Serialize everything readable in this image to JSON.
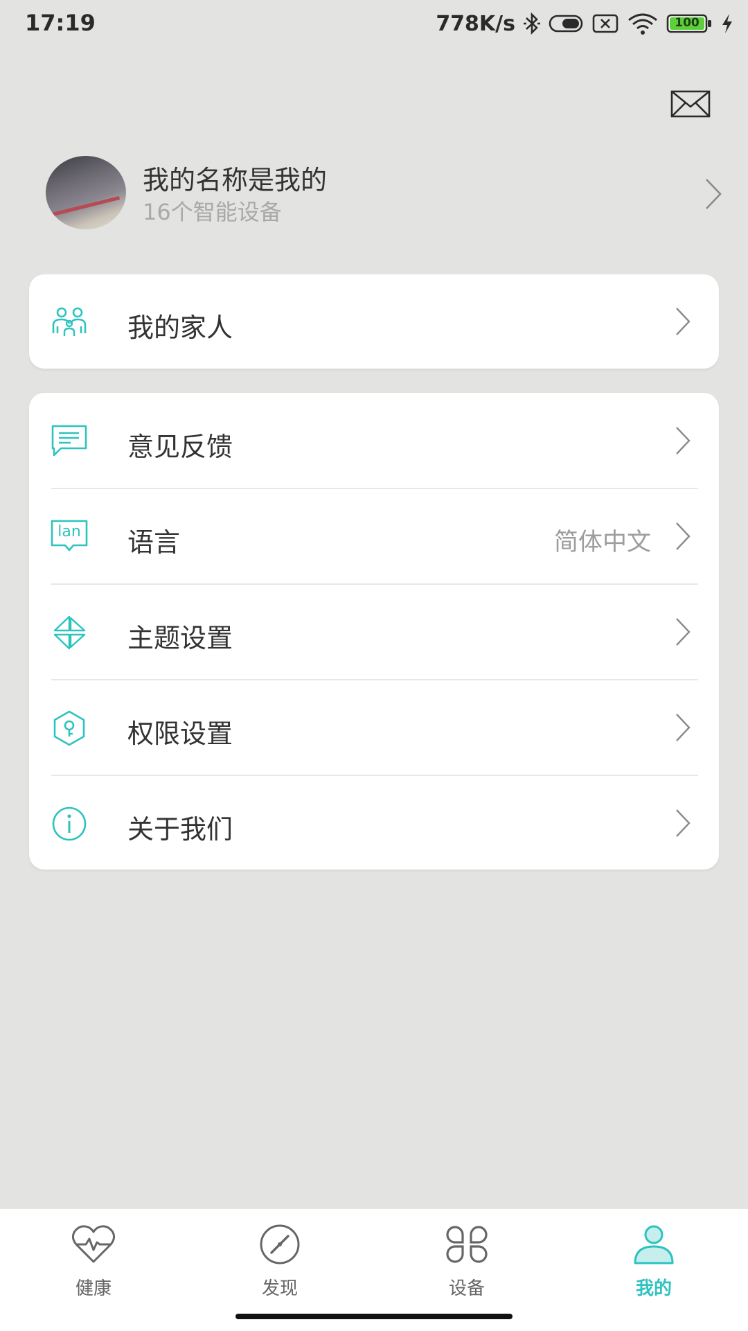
{
  "status_bar": {
    "time": "17:19",
    "net_speed": "778K/s",
    "battery": "100",
    "icons": [
      "bluetooth-icon",
      "toggle-icon",
      "sim-x-icon",
      "wifi-icon",
      "battery-icon",
      "charging-icon"
    ]
  },
  "header": {
    "mail_icon": "mail-icon"
  },
  "profile": {
    "name": "我的名称是我的",
    "device_count": "16个智能设备"
  },
  "family": {
    "label": "我的家人",
    "icon": "family-icon"
  },
  "menu": [
    {
      "label": "意见反馈",
      "icon": "feedback-icon",
      "value": ""
    },
    {
      "label": "语言",
      "icon": "language-icon",
      "icon_text": "lan",
      "value": "简体中文"
    },
    {
      "label": "主题设置",
      "icon": "theme-icon",
      "value": ""
    },
    {
      "label": "权限设置",
      "icon": "permission-icon",
      "value": ""
    },
    {
      "label": "关于我们",
      "icon": "info-icon",
      "value": ""
    }
  ],
  "bottom_nav": [
    {
      "label": "健康",
      "icon": "heart-pulse-icon",
      "active": false
    },
    {
      "label": "发现",
      "icon": "compass-icon",
      "active": false
    },
    {
      "label": "设备",
      "icon": "devices-icon",
      "active": false
    },
    {
      "label": "我的",
      "icon": "person-icon",
      "active": true
    }
  ],
  "colors": {
    "accent": "#2dc3bf",
    "background": "#e3e3e1",
    "card": "#ffffff",
    "nav_inactive": "#666666"
  }
}
